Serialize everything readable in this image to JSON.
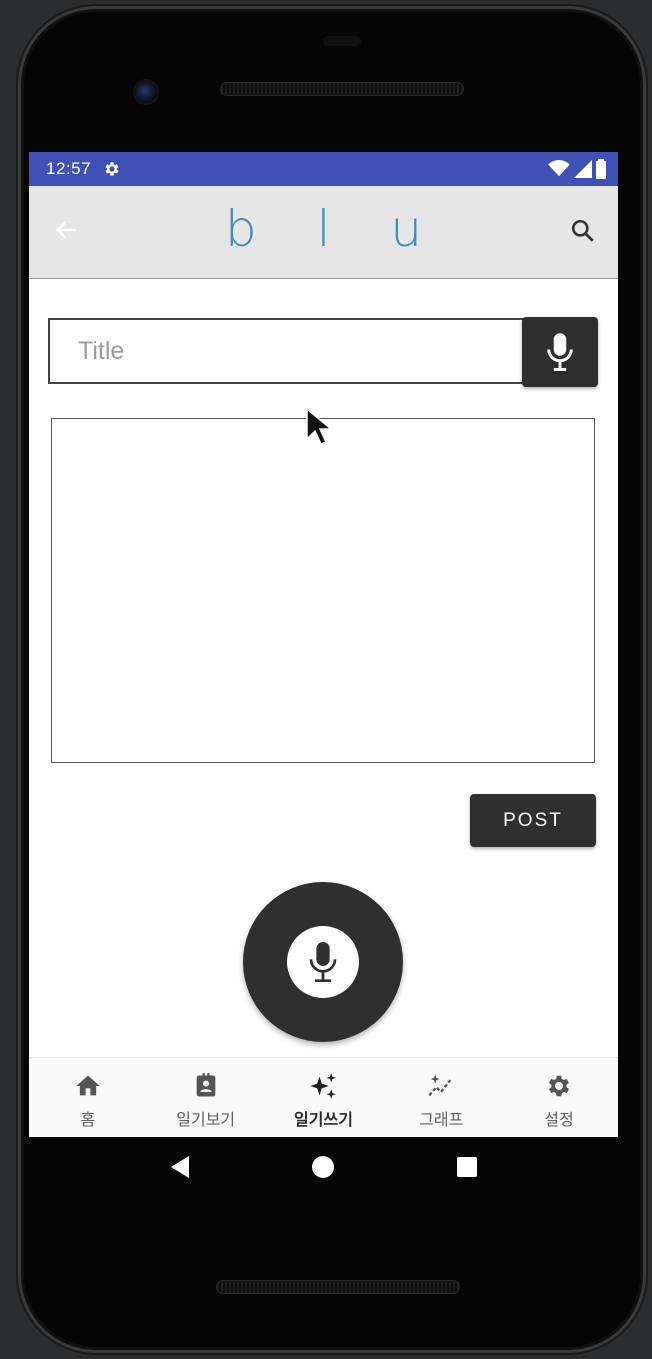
{
  "status_bar": {
    "time": "12:57"
  },
  "app_bar": {
    "logo": "b l u"
  },
  "editor": {
    "title_placeholder": "Title",
    "title_value": "",
    "body_value": "",
    "post_label": "POST"
  },
  "bottom_nav": {
    "items": [
      {
        "label": "홈",
        "icon": "home-icon",
        "active": false
      },
      {
        "label": "일기보기",
        "icon": "diary-view-icon",
        "active": false
      },
      {
        "label": "일기쓰기",
        "icon": "sparkle-write-icon",
        "active": true
      },
      {
        "label": "그래프",
        "icon": "graph-icon",
        "active": false
      },
      {
        "label": "설정",
        "icon": "gear-icon",
        "active": false
      }
    ]
  },
  "colors": {
    "status_bar": "#3f51b5",
    "app_bar": "#e6e6e6",
    "logo": "#3d8cc3",
    "dark_button": "#2f2f2f"
  }
}
